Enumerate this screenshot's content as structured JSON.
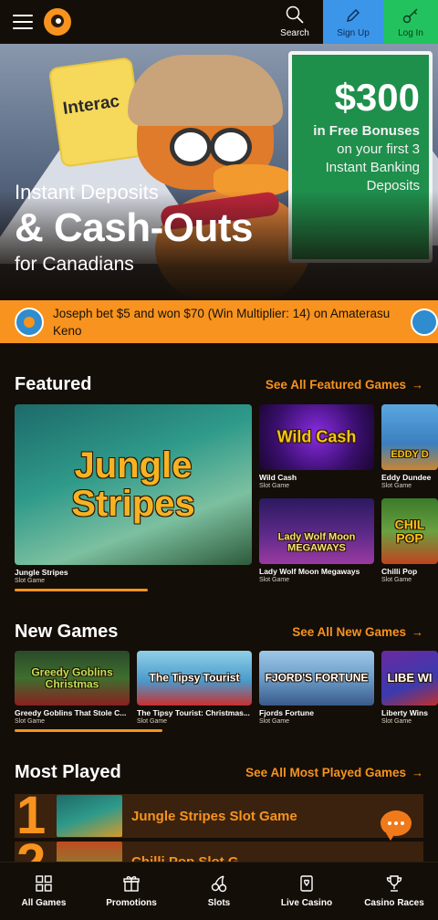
{
  "header": {
    "search_label": "Search",
    "signup_label": "Sign Up",
    "login_label": "Log In",
    "colors": {
      "signup_bg": "#3b95e8",
      "login_bg": "#22c35e",
      "accent": "#f7931e"
    }
  },
  "hero": {
    "card_brand": "Interac",
    "promo_amount": "$300",
    "promo_line1": "in Free Bonuses",
    "promo_line2": "on your first 3",
    "promo_line3": "Instant Banking",
    "promo_line4": "Deposits",
    "subtitle_top": "Instant Deposits",
    "title": "& Cash-Outs",
    "subtitle_bottom": "for Canadians"
  },
  "ticker": {
    "message": "Joseph bet $5 and won $70 (Win Multiplier: 14) on Amaterasu Keno"
  },
  "featured": {
    "title": "Featured",
    "see_all": "See All Featured Games",
    "games": [
      {
        "name": "Jungle Stripes",
        "category": "Slot Game",
        "art": "Jungle Stripes"
      },
      {
        "name": "Wild Cash",
        "category": "Slot Game",
        "art": "Wild Cash"
      },
      {
        "name": "Eddy Dundee",
        "category": "Slot Game",
        "art": "EDDY D"
      },
      {
        "name": "Lady Wolf Moon Megaways",
        "category": "Slot Game",
        "art": "Lady Wolf Moon MEGAWAYS"
      },
      {
        "name": "Chilli Pop",
        "category": "Slot Game",
        "art": "CHIL POP"
      }
    ]
  },
  "new_games": {
    "title": "New Games",
    "see_all": "See All New Games",
    "games": [
      {
        "name": "Greedy Goblins That Stole C...",
        "category": "Slot Game",
        "art": "Greedy Goblins Christmas"
      },
      {
        "name": "The Tipsy Tourist: Christmas...",
        "category": "Slot Game",
        "art": "The Tipsy Tourist"
      },
      {
        "name": "Fjords Fortune",
        "category": "Slot Game",
        "art": "FJORD'S FORTUNE"
      },
      {
        "name": "Liberty Wins",
        "category": "Slot Game",
        "art": "LIBE WI"
      }
    ]
  },
  "most_played": {
    "title": "Most Played",
    "see_all": "See All Most Played Games",
    "rows": [
      {
        "rank": "1",
        "label": "Jungle Stripes Slot Game"
      },
      {
        "rank": "2",
        "label": "Chilli Pop Slot G"
      }
    ]
  },
  "bottom_nav": {
    "items": [
      {
        "label": "All Games",
        "icon": "grid-icon"
      },
      {
        "label": "Promotions",
        "icon": "gift-icon"
      },
      {
        "label": "Slots",
        "icon": "cherries-icon"
      },
      {
        "label": "Live Casino",
        "icon": "card-icon"
      },
      {
        "label": "Casino Races",
        "icon": "trophy-icon"
      }
    ]
  }
}
